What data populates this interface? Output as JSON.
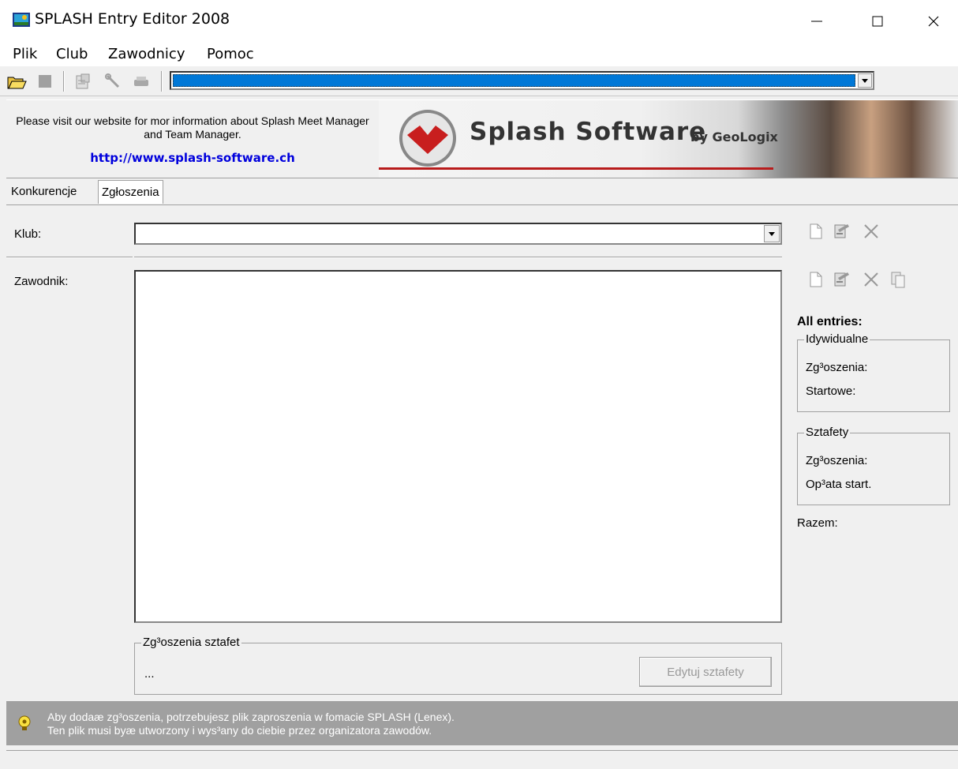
{
  "window": {
    "title": "SPLASH Entry Editor 2008",
    "min_glyph": "—",
    "max_glyph": "☐",
    "close_glyph": "✕"
  },
  "menu": {
    "items": [
      "Plik",
      "Club",
      "Zawodnicy",
      "Pomoc"
    ]
  },
  "banner": {
    "text": "Please visit our website for mor information about Splash Meet Manager and Team Manager.",
    "link": "http://www.splash-software.ch",
    "brand": "Splash Software",
    "by": "by GeoLogix"
  },
  "tabs": [
    "Konkurencje",
    "Zgłoszenia"
  ],
  "form": {
    "klub_label": "Klub:",
    "klub_value": "",
    "zawodnik_label": "Zawodnik:"
  },
  "relays": {
    "legend": "Zg³oszenia sztafet",
    "value": "...",
    "edit_button": "Edytuj sztafety"
  },
  "stats": {
    "title": "All entries:",
    "individual": {
      "legend": "Idywidualne",
      "entries_label": "Zg³oszenia:",
      "starts_label": "Startowe:"
    },
    "relays": {
      "legend": "Sztafety",
      "entries_label": "Zg³oszenia:",
      "fee_label": "Op³ata start."
    },
    "total_label": "Razem:"
  },
  "hint": {
    "line1": "Aby dodaæ zg³oszenia, potrzebujesz plik zaproszenia w fomacie SPLASH (Lenex).",
    "line2": "Ten plik musi byæ utworzony i wys³any do ciebie przez organizatora zawodów."
  },
  "colors": {
    "selection": "#0078d7",
    "link": "#0000dd",
    "hintbar": "#a0a0a0"
  }
}
